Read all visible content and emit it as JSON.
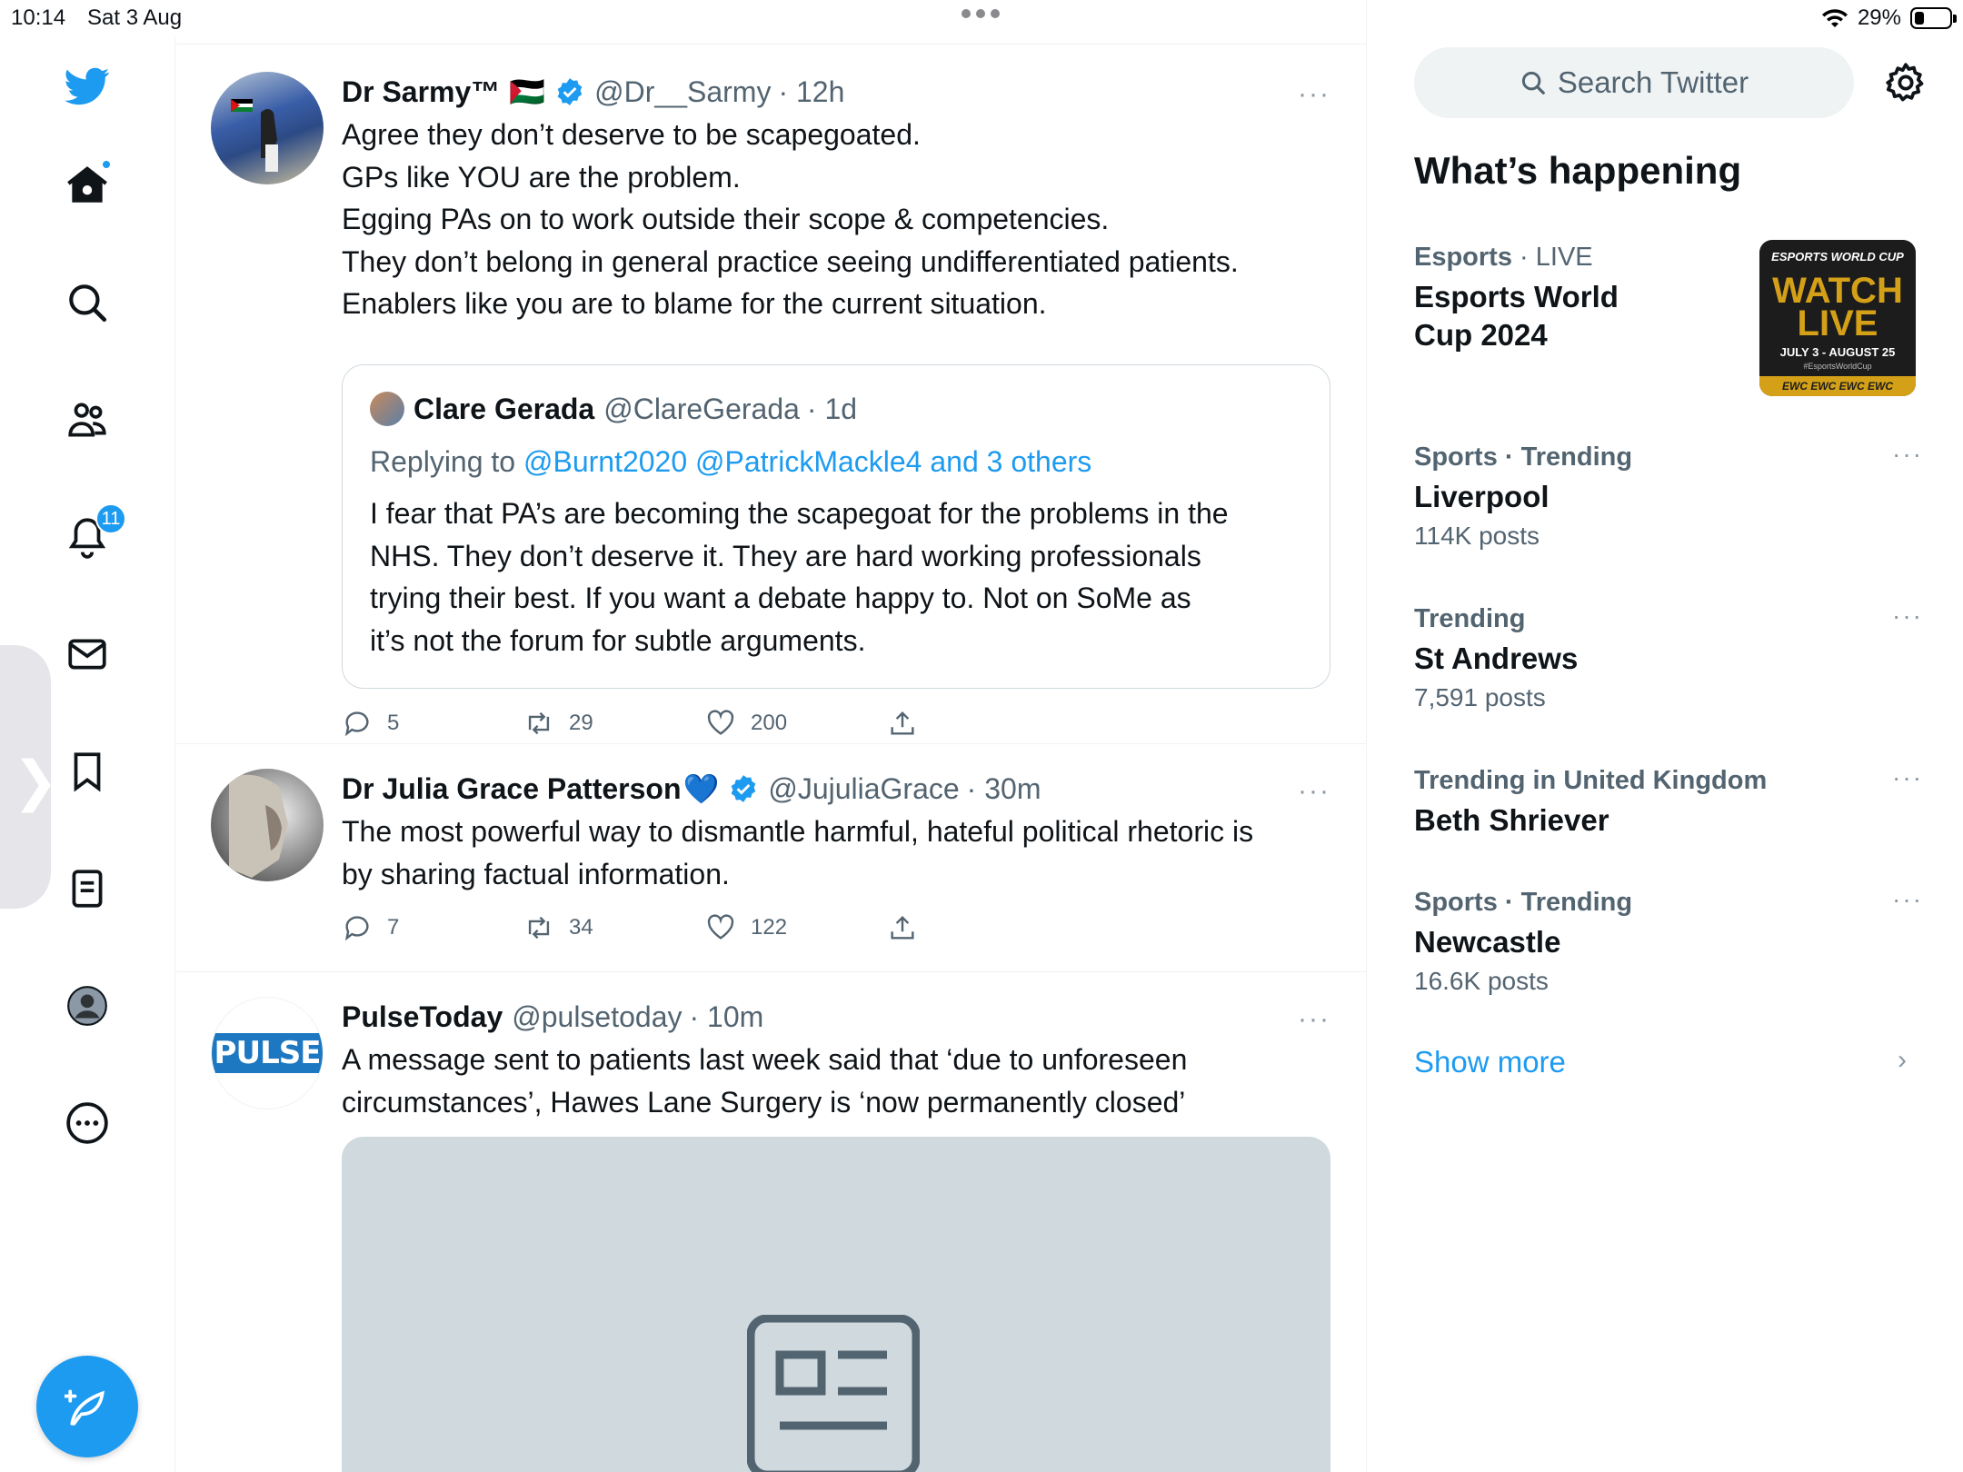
{
  "status_bar": {
    "time": "10:14",
    "date": "Sat 3 Aug",
    "battery_pct": "29%",
    "battery_level": 0.29
  },
  "nav": {
    "notifications_badge": "11",
    "home_has_dot": true
  },
  "tweets": [
    {
      "name": "Dr Sarmy™",
      "flag": "🇵🇸",
      "handle": "@Dr__Sarmy",
      "time": "· 12h",
      "more": "···",
      "lines": [
        "Agree they don’t deserve to be scapegoated.",
        "GPs like YOU are the problem.",
        "Egging PAs on to work outside their scope & competencies.",
        "They don’t belong in general practice seeing undifferentiated patients.",
        "Enablers like you are to blame for the current situation."
      ],
      "quote": {
        "name": "Clare Gerada",
        "handle": "@ClareGerada",
        "time": "· 1d",
        "replying_prefix": "Replying to",
        "replying_to": "@Burnt2020 @PatrickMackle4 and 3 others",
        "lines": [
          "I fear that PA’s are becoming the scapegoat for the problems in the",
          "NHS. They don’t deserve it. They are hard working professionals",
          "trying their best. If you want a debate happy to.  Not on SoMe as",
          "it’s not the forum for subtle arguments."
        ]
      },
      "replies": "5",
      "retweets": "29",
      "likes": "200"
    },
    {
      "name": "Dr Julia Grace Patterson",
      "emoji": "💙",
      "handle": "@JujuliaGrace",
      "time": "· 30m",
      "more": "···",
      "lines": [
        "The most powerful way to dismantle harmful, hateful political rhetoric is",
        "by sharing factual information."
      ],
      "replies": "7",
      "retweets": "34",
      "likes": "122"
    },
    {
      "name": "PulseToday",
      "handle": "@pulsetoday",
      "time": "· 10m",
      "more": "···",
      "avatar_text": "PULSE",
      "lines": [
        "A message sent to patients last week said that ‘due to unforeseen",
        "circumstances’, Hawes Lane Surgery is ‘now permanently closed’"
      ]
    }
  ],
  "sidebar": {
    "search_placeholder": "Search Twitter",
    "whats_happening": "What’s happening",
    "trends": [
      {
        "ctx_bold": "Esports",
        "ctx_rest": " · LIVE",
        "title": "Esports World Cup 2024",
        "count": ""
      },
      {
        "ctx_bold": "Sports · Trending",
        "ctx_rest": "",
        "title": "Liverpool",
        "count": "114K posts"
      },
      {
        "ctx_bold": "Trending",
        "ctx_rest": "",
        "title": "St Andrews",
        "count": "7,591 posts"
      },
      {
        "ctx_bold": "Trending in United Kingdom",
        "ctx_rest": "",
        "title": "Beth Shriever",
        "count": ""
      },
      {
        "ctx_bold": "Sports · Trending",
        "ctx_rest": "",
        "title": "Newcastle",
        "count": "16.6K posts"
      }
    ],
    "esports_image": {
      "top": "ESPORTS WORLD CUP",
      "watch": "WATCH",
      "live": "LIVE",
      "dates": "JULY 3 - AUGUST 25",
      "tag": "#EsportsWorldCup",
      "ticker": "EWC EWC EWC EWC"
    },
    "show_more": "Show more",
    "more_dots": "···"
  },
  "colors": {
    "accent": "#1d9bf0",
    "muted": "#536471",
    "border": "#eff3f4"
  }
}
